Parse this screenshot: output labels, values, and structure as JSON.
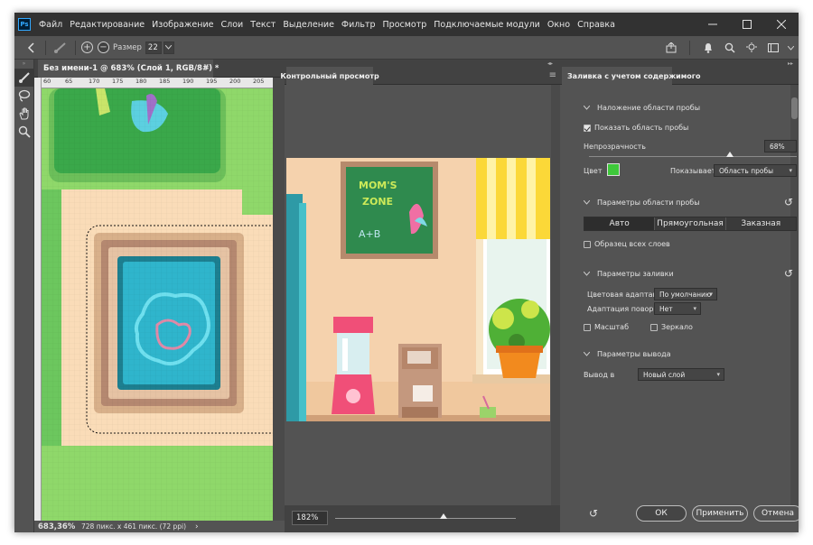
{
  "app": {
    "logo": "Ps"
  },
  "menu": [
    "Файл",
    "Редактирование",
    "Изображение",
    "Слои",
    "Текст",
    "Выделение",
    "Фильтр",
    "Просмотр",
    "Подключаемые модули",
    "Окно",
    "Справка"
  ],
  "options_bar": {
    "size_label": "Размер",
    "size_value": "22"
  },
  "document": {
    "tab_title": "Без имени-1 @ 683% (Слой 1, RGB/8#) *",
    "ruler_ticks": [
      "60",
      "65",
      "170",
      "175",
      "180",
      "185",
      "190",
      "195",
      "200",
      "205"
    ],
    "zoom": "683,36%",
    "info": "728 пикс. x 461 пикс. (72 ppi)"
  },
  "preview": {
    "tab_title": "Контрольный просмотр",
    "zoom": "182%",
    "zoom_level": 0.6,
    "board_text": [
      "MOM'S",
      "ZONE",
      "A+B"
    ]
  },
  "fill_panel": {
    "tab_title": "Заливка с учетом содержимого",
    "sample_overlay": {
      "title": "Наложение области пробы",
      "show_label": "Показать область пробы",
      "show_checked": true,
      "opacity_label": "Непрозрачность",
      "opacity_value": "68%",
      "opacity": 0.68,
      "color_label": "Цвет",
      "color": "#3ec83a",
      "shows_label": "Показывает",
      "shows_value": "Область пробы"
    },
    "sampling": {
      "title": "Параметры области пробы",
      "modes": [
        "Авто",
        "Прямоугольная",
        "Заказная"
      ],
      "selected_mode": "Авто",
      "all_layers_label": "Образец всех слоев",
      "all_layers_checked": false
    },
    "fill_settings": {
      "title": "Параметры заливки",
      "color_adapt_label": "Цветовая адаптация",
      "color_adapt_value": "По умолчанию",
      "rotation_label": "Адаптация поворота",
      "rotation_value": "Нет",
      "scale_label": "Масштаб",
      "scale_checked": false,
      "mirror_label": "Зеркало",
      "mirror_checked": false
    },
    "output": {
      "title": "Параметры вывода",
      "output_label": "Вывод в",
      "output_value": "Новый слой"
    },
    "buttons": {
      "ok": "ОК",
      "apply": "Применить",
      "cancel": "Отмена"
    }
  }
}
